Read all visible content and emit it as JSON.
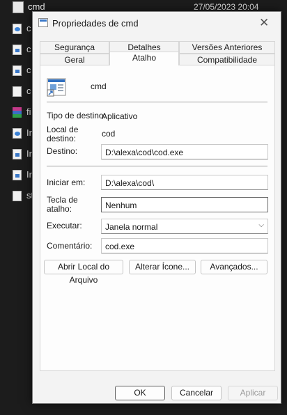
{
  "background": {
    "title": "cmd",
    "datetime": "27/05/2023 20:04",
    "items": [
      {
        "label": "c",
        "icon": "blue-doc-icon"
      },
      {
        "label": "c",
        "icon": "exe-icon"
      },
      {
        "label": "c",
        "icon": "exe-icon"
      },
      {
        "label": "c",
        "icon": "doc-icon"
      },
      {
        "label": "fi",
        "icon": "rar-icon"
      },
      {
        "label": "Ir",
        "icon": "blue-doc-icon"
      },
      {
        "label": "Ir",
        "icon": "exe-icon"
      },
      {
        "label": "Ir",
        "icon": "exe-icon"
      },
      {
        "label": "st",
        "icon": "doc-icon"
      }
    ]
  },
  "dialog": {
    "title": "Propriedades de cmd",
    "tabs_row1": [
      "Segurança",
      "Detalhes",
      "Versões Anteriores"
    ],
    "tabs_row2": [
      "Geral",
      "Atalho",
      "Compatibilidade"
    ],
    "active_tab": "Atalho",
    "shortcut_name": "cmd",
    "tipo_destino_label": "Tipo de destino:",
    "tipo_destino_value": "Aplicativo",
    "local_destino_label": "Local de destino:",
    "local_destino_value": "cod",
    "destino_label": "Destino:",
    "destino_value": "D:\\alexa\\cod\\cod.exe",
    "iniciar_label": "Iniciar em:",
    "iniciar_value": "D:\\alexa\\cod\\",
    "tecla_label": "Tecla de atalho:",
    "tecla_value": "Nenhum",
    "executar_label": "Executar:",
    "executar_value": "Janela normal",
    "comentario_label": "Comentário:",
    "comentario_value": "cod.exe",
    "btn_abrir": "Abrir Local do Arquivo",
    "btn_alterar": "Alterar Ícone...",
    "btn_avancados": "Avançados...",
    "btn_ok": "OK",
    "btn_cancelar": "Cancelar",
    "btn_aplicar": "Aplicar"
  }
}
